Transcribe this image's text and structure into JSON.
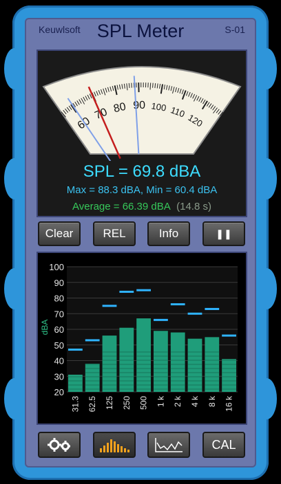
{
  "header": {
    "brand": "Keuwlsoft",
    "title": "SPL Meter",
    "model": "S-01"
  },
  "meter": {
    "scale_labels": [
      "60",
      "70",
      "80",
      "90",
      "100",
      "110",
      "120"
    ],
    "needle_value": 69.8,
    "max_marker": 88.3,
    "min_marker": 60.4,
    "colors": {
      "needle": "#c41e1e",
      "max": "#7fa0e8",
      "min": "#7fa0e8",
      "face": "#f5f2e4"
    }
  },
  "readings": {
    "spl": "SPL = 69.8 dBA",
    "max_min": "Max = 88.3 dBA,  Min = 60.4 dBA",
    "average": "Average = 66.39 dBA",
    "duration": "(14.8 s)"
  },
  "buttons": {
    "clear": "Clear",
    "rel": "REL",
    "info": "Info",
    "pause": "❚❚"
  },
  "chart_data": {
    "type": "bar",
    "ylabel": "dBA",
    "ylim": [
      20,
      100
    ],
    "yticks": [
      "100",
      "90",
      "80",
      "70",
      "60",
      "50",
      "40",
      "30",
      "20"
    ],
    "categories": [
      "31.3",
      "62.5",
      "125",
      "250",
      "500",
      "1 k",
      "2 k",
      "4 k",
      "8 k",
      "16 k"
    ],
    "values": [
      31,
      38,
      56,
      61,
      67,
      59,
      58,
      54,
      55,
      41
    ],
    "peaks": [
      47,
      53,
      75,
      84,
      85,
      66,
      76,
      70,
      73,
      56
    ],
    "colors": {
      "bar": "#1f9d7a",
      "peak": "#2fb4ff"
    }
  },
  "bottom_bar": {
    "settings_icon": "gears-icon",
    "spectrum_icon": "bars-icon",
    "trace_icon": "trace-icon",
    "cal": "CAL"
  }
}
